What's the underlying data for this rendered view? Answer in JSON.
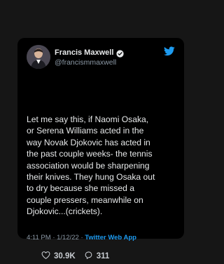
{
  "tweet": {
    "display_name": "Francis Maxwell",
    "handle": "@francismmaxwell",
    "lines": [
      "Let me say this, if Naomi Osaka,",
      "or Serena Williams acted in the",
      "way Novak Djokovic has acted in",
      "the past couple weeks- the tennis",
      "association would be sharpening",
      "their knives. They hung Osaka out",
      "to dry because she missed a",
      "couple pressers, meanwhile on",
      "Djokovic...(crickets)."
    ],
    "time": "4:11 PM · 1/12/22 · ",
    "source": "Twitter Web App",
    "likes": "30.9K",
    "replies": "311"
  },
  "icons": {
    "verified": "verified-badge-icon",
    "brand": "twitter-bird-icon",
    "like": "heart-icon",
    "reply": "reply-bubble-icon"
  },
  "colors": {
    "background": "#161616",
    "card": "#000000",
    "accent": "#1d9bf0",
    "text": "#e7e9ea",
    "muted": "#8b98a5"
  }
}
